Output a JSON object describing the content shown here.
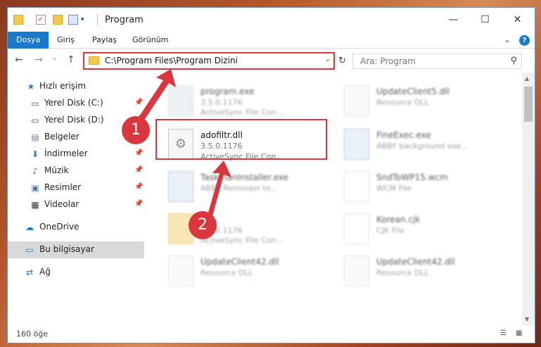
{
  "window": {
    "title": "Program",
    "controls": {
      "minimize": "—",
      "maximize": "☐",
      "close": "✕"
    }
  },
  "ribbon": {
    "tabs": [
      "Dosya",
      "Giriş",
      "Paylaş",
      "Görünüm"
    ],
    "expand_icon": "chevron-down-icon",
    "help": "?"
  },
  "nav": {
    "back": "←",
    "forward": "→",
    "recent": "⌄",
    "up": "↑",
    "address": "C:\\Program Files\\Program Dizini",
    "address_drop": "⌄",
    "refresh": "↻",
    "search_placeholder": "Ara: Program",
    "search_icon": "⚲"
  },
  "sidebar": {
    "items": [
      {
        "label": "Hızlı erişim",
        "icon": "★",
        "pinned": false
      },
      {
        "label": "Yerel Disk (C:)",
        "icon": "▭",
        "pinned": true
      },
      {
        "label": "Yerel Disk (D:)",
        "icon": "▭",
        "pinned": true
      },
      {
        "label": "Belgeler",
        "icon": "▤",
        "pinned": true
      },
      {
        "label": "İndirmeler",
        "icon": "⬇",
        "pinned": true
      },
      {
        "label": "Müzik",
        "icon": "♪",
        "pinned": true
      },
      {
        "label": "Resimler",
        "icon": "▣",
        "pinned": true
      },
      {
        "label": "Videolar",
        "icon": "▦",
        "pinned": true
      },
      {
        "label": "OneDrive",
        "icon": "☁",
        "pinned": false
      },
      {
        "label": "Bu bilgisayar",
        "icon": "▭",
        "pinned": false
      },
      {
        "label": "Ağ",
        "icon": "⇄",
        "pinned": false
      }
    ]
  },
  "files": [
    {
      "name": "program.exe",
      "line1": "3.5.0.1176",
      "line2": "ActiveSync File Con..."
    },
    {
      "name": "UpdateClient5.dll",
      "line1": "Resource DLL",
      "line2": ""
    },
    {
      "name": "adofiltr.dll",
      "line1": "3.5.0.1176",
      "line2": "ActiveSync File Con..."
    },
    {
      "name": "FineExec.exe",
      "line1": "ABBY background exe...",
      "line2": ""
    },
    {
      "name": "TaskmanInstaller.exe",
      "line1": "ABBY Reminder to...",
      "line2": ""
    },
    {
      "name": "SndToWP15.wcm",
      "line1": "WCM File",
      "line2": ""
    },
    {
      "name": "...",
      "line1": "3.5.0.1176",
      "line2": "ActiveSync File Con..."
    },
    {
      "name": "Korean.cjk",
      "line1": "CJK File",
      "line2": ""
    },
    {
      "name": "UpdateClient42.dll",
      "line1": "Resource DLL",
      "line2": ""
    },
    {
      "name": "UpdateClient42.dll",
      "line1": "Resource DLL",
      "line2": ""
    }
  ],
  "status": {
    "count": "160 öğe"
  },
  "callouts": {
    "one": "1",
    "two": "2"
  },
  "colors": {
    "accent": "#1979ca",
    "highlight": "#d9363e"
  }
}
